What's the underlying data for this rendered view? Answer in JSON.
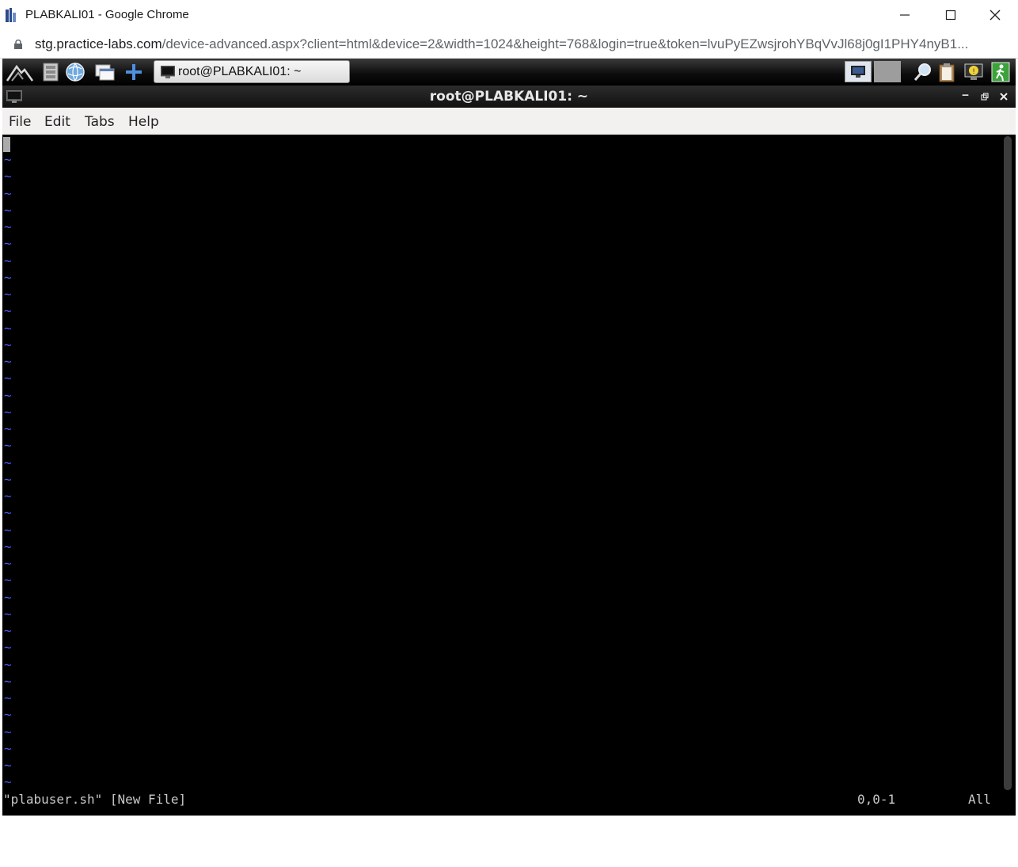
{
  "browser": {
    "window_title": "PLABKALI01 - Google Chrome",
    "url_host": "stg.practice-labs.com",
    "url_path": "/device-advanced.aspx?client=html&device=2&width=1024&height=768&login=true&token=lvuPyEZwsjrohYBqVvJl68j0gI1PHY4nyB1..."
  },
  "desktop": {
    "panel_icons": [
      "kali-menu-icon",
      "file-cabinet-icon",
      "browser-globe-icon",
      "show-desktop-icon",
      "add-launcher-icon"
    ],
    "task_label": "root@PLABKALI01: ~",
    "tray_icons": [
      "workspace-1",
      "workspace-2",
      "search-icon",
      "clipboard-icon",
      "notification-icon",
      "logout-icon"
    ]
  },
  "terminal": {
    "title": "root@PLABKALI01: ~",
    "menu": [
      "File",
      "Edit",
      "Tabs",
      "Help"
    ],
    "tilde": "~",
    "status_filename": "\"plabuser.sh\" [New File]",
    "status_position": "0,0-1",
    "status_scroll": "All"
  },
  "colors": {
    "tilde": "#4a5cf0",
    "terminal_bg": "#000000"
  }
}
